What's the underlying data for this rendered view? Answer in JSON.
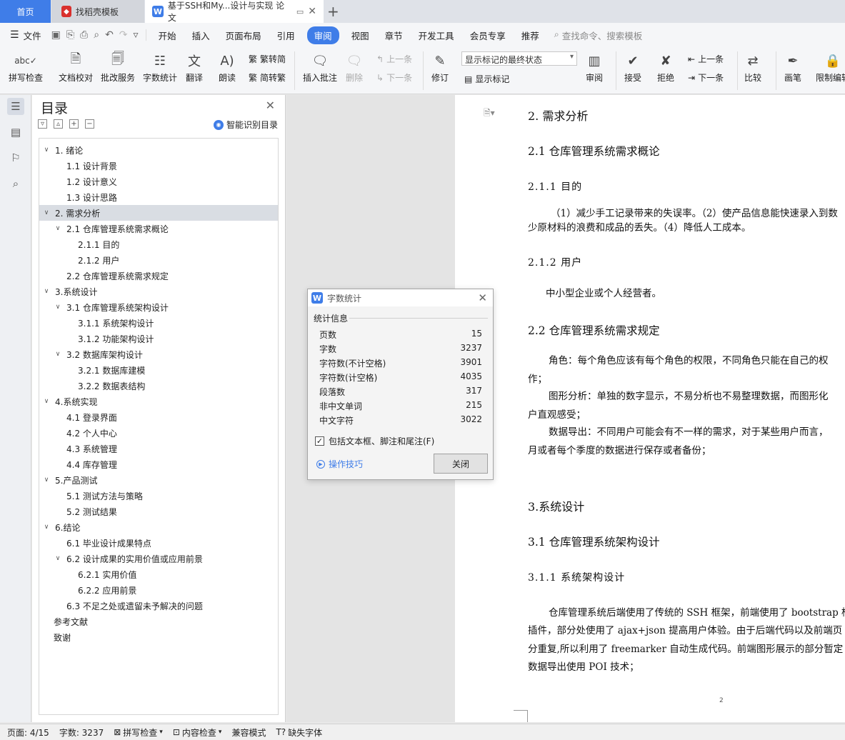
{
  "tabs": {
    "home": "首页",
    "template": "找稻壳模板",
    "document": "基于SSH和My...设计与实现 论文"
  },
  "menu": {
    "file": "文件",
    "items": [
      "开始",
      "插入",
      "页面布局",
      "引用",
      "审阅",
      "视图",
      "章节",
      "开发工具",
      "会员专享",
      "推荐"
    ],
    "active": "审阅",
    "search_placeholder": "查找命令、搜索模板"
  },
  "ribbon": {
    "spellcheck": "拼写检查",
    "doc_proof": "文档校对",
    "review_service": "批改服务",
    "word_count": "字数统计",
    "translate": "翻译",
    "read_aloud": "朗读",
    "trad_simp": "繁转简",
    "simp_trad": "简转繁",
    "insert_comment": "插入批注",
    "delete": "删除",
    "prev": "上一条",
    "next": "下一条",
    "track_changes": "修订",
    "markup_state": "显示标记的最终状态",
    "show_markup": "显示标记",
    "review": "审阅",
    "accept": "接受",
    "reject": "拒绝",
    "prev2": "上一条",
    "next2": "下一条",
    "compare": "比较",
    "pen": "画笔",
    "restrict_edit": "限制编辑"
  },
  "toc": {
    "title": "目录",
    "smart_label": "智能识别目录",
    "items": [
      {
        "text": "1. 绪论",
        "level": 1,
        "caret": true
      },
      {
        "text": "1.1  设计背景",
        "level": 2
      },
      {
        "text": "1.2  设计意义",
        "level": 2
      },
      {
        "text": "1.3  设计思路",
        "level": 2
      },
      {
        "text": "2. 需求分析",
        "level": 1,
        "caret": true,
        "selected": true
      },
      {
        "text": "2.1  仓库管理系统需求概论",
        "level": 2,
        "caret": true
      },
      {
        "text": "2.1.1  目的",
        "level": 3
      },
      {
        "text": "2.1.2  用户",
        "level": 3
      },
      {
        "text": "2.2  仓库管理系统需求规定",
        "level": 2
      },
      {
        "text": "3.系统设计",
        "level": 1,
        "caret": true
      },
      {
        "text": "3.1  仓库管理系统架构设计",
        "level": 2,
        "caret": true
      },
      {
        "text": "3.1.1  系统架构设计",
        "level": 3
      },
      {
        "text": "3.1.2  功能架构设计",
        "level": 3
      },
      {
        "text": "3.2  数据库架构设计",
        "level": 2,
        "caret": true
      },
      {
        "text": "3.2.1  数据库建模",
        "level": 3
      },
      {
        "text": "3.2.2  数据表结构",
        "level": 3
      },
      {
        "text": "4.系统实现",
        "level": 1,
        "caret": true
      },
      {
        "text": "4.1  登录界面",
        "level": 2
      },
      {
        "text": "4.2 个人中心",
        "level": 2
      },
      {
        "text": "4.3  系统管理",
        "level": 2
      },
      {
        "text": "4.4  库存管理",
        "level": 2
      },
      {
        "text": "5.产品测试",
        "level": 1,
        "caret": true
      },
      {
        "text": "5.1 测试方法与策略",
        "level": 2
      },
      {
        "text": "5.2 测试结果",
        "level": 2
      },
      {
        "text": "6.结论",
        "level": 1,
        "caret": true
      },
      {
        "text": "6.1  毕业设计成果特点",
        "level": 2
      },
      {
        "text": "6.2  设计成果的实用价值或应用前景",
        "level": 2,
        "caret": true
      },
      {
        "text": "6.2.1 实用价值",
        "level": 3
      },
      {
        "text": "6.2.2 应用前景",
        "level": 3
      },
      {
        "text": "6.3  不足之处或遗留未予解决的问题",
        "level": 2
      },
      {
        "text": "参考文献",
        "level": 0
      },
      {
        "text": "致谢",
        "level": 0
      }
    ]
  },
  "document": {
    "h_2": "2.  需求分析",
    "h_2_1": "2.1  仓库管理系统需求概论",
    "h_2_1_1": "2.1.1  目的",
    "p_purpose_1": "（1）减少手工记录带来的失误率。（2）使产品信息能快速录入到数",
    "p_purpose_2": "少原材料的浪费和成品的丢失。（4）降低人工成本。",
    "h_2_1_2": "2.1.2  用户",
    "p_user": "中小型企业或个人经营者。",
    "h_2_2": "2.2  仓库管理系统需求规定",
    "p_role_1": "角色：每个角色应该有每个角色的权限，不同角色只能在自己的权",
    "p_role_2": "作；",
    "p_graph_1": "图形分析：单独的数字显示，不易分析也不易整理数据，而图形化",
    "p_graph_2": "户直观感受；",
    "p_export_1": "数据导出：不同用户可能会有不一样的需求，对于某些用户而言，",
    "p_export_2": "月或者每个季度的数据进行保存或者备份；",
    "h_3": "3.系统设计",
    "h_3_1": "3.1  仓库管理系统架构设计",
    "h_3_1_1": "3.1.1  系统架构设计",
    "p_arch_1": "仓库管理系统后端使用了传统的 SSH 框架，前端使用了 bootstrap 框",
    "p_arch_2": "插件，部分处使用了 ajax+json 提高用户体验。由于后端代码以及前端页",
    "p_arch_3": "分重复,所以利用了 freemarker 自动生成代码。前端图形展示的部分暂定",
    "p_arch_4": "数据导出使用 POI 技术；",
    "page_number": "2"
  },
  "dialog": {
    "title": "字数统计",
    "group": "统计信息",
    "stats": [
      {
        "label": "页数",
        "value": "15"
      },
      {
        "label": "字数",
        "value": "3237"
      },
      {
        "label": "字符数(不计空格)",
        "value": "3901"
      },
      {
        "label": "字符数(计空格)",
        "value": "4035"
      },
      {
        "label": "段落数",
        "value": "317"
      },
      {
        "label": "非中文单词",
        "value": "215"
      },
      {
        "label": "中文字符",
        "value": "3022"
      }
    ],
    "checkbox_label": "包括文本框、脚注和尾注(F)",
    "tips": "操作技巧",
    "close": "关闭"
  },
  "status": {
    "page": "页面: 4/15",
    "words": "字数: 3237",
    "spell": "拼写检查",
    "content": "内容检查",
    "compat": "兼容模式",
    "missing_font": "缺失字体"
  },
  "colors": {
    "accent": "#3f7de8",
    "template_red": "#d9302d"
  }
}
